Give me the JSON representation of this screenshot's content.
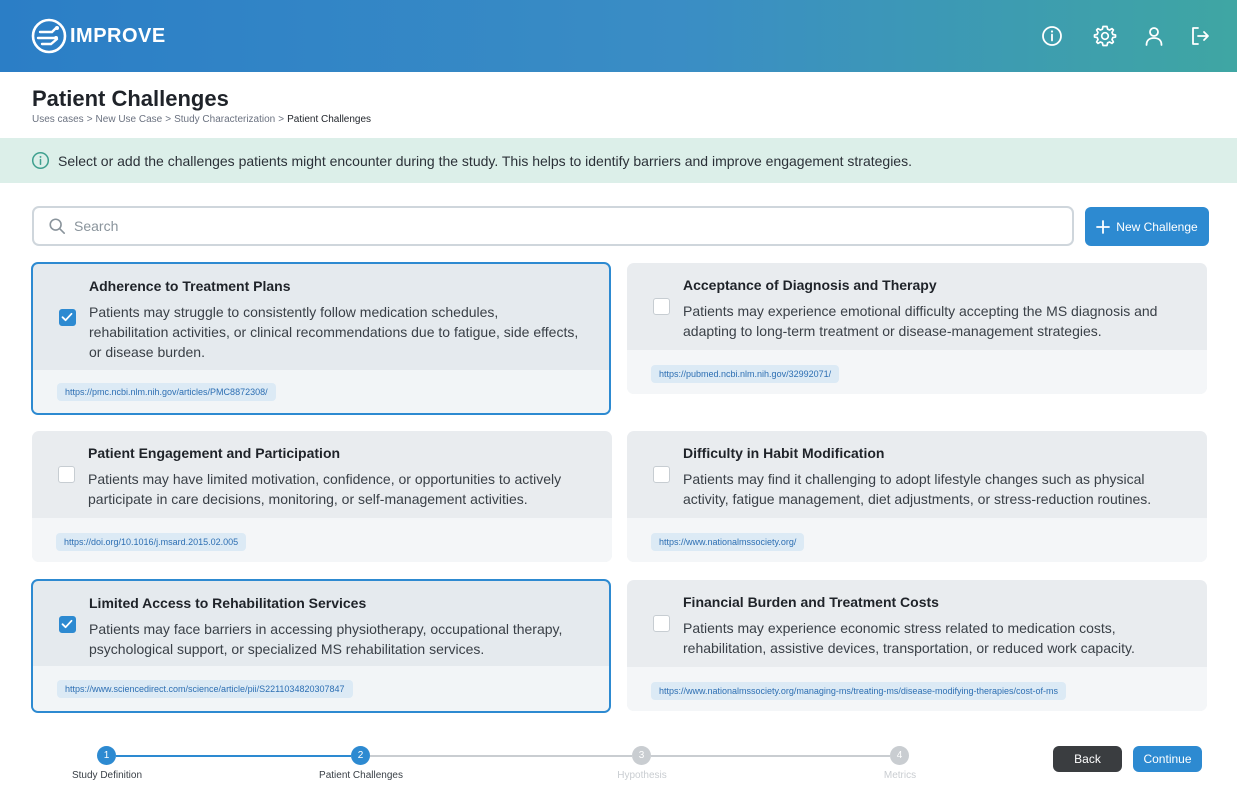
{
  "app": {
    "logo_text": "IMPROVE",
    "header_icons": [
      "info-icon",
      "gear-icon",
      "user-icon",
      "logout-icon"
    ]
  },
  "page": {
    "title": "Patient Challenges",
    "breadcrumb": [
      "Uses cases",
      "New Use Case",
      "Study Characterization",
      "Patient Challenges"
    ],
    "breadcrumb_sep": ">"
  },
  "banner": {
    "text": "Select or add the challenges patients might encounter during the study. This helps to identify barriers and improve engagement strategies."
  },
  "search": {
    "placeholder": "Search",
    "value": ""
  },
  "new_challenge_label": "New Challenge",
  "challenges": [
    {
      "title": "Adherence to Treatment Plans",
      "description": "Patients may struggle to consistently follow medication schedules, rehabilitation activities, or clinical recommendations due to fatigue, side effects, or disease burden.",
      "link": "https://pmc.ncbi.nlm.nih.gov/articles/PMC8872308/",
      "checked": true
    },
    {
      "title": "Acceptance of Diagnosis and Therapy",
      "description": "Patients may experience emotional difficulty accepting the MS diagnosis and adapting to long-term treatment or disease-management strategies.",
      "link": "https://pubmed.ncbi.nlm.nih.gov/32992071/",
      "checked": false
    },
    {
      "title": "Patient Engagement and Participation",
      "description": "Patients may have limited motivation, confidence, or opportunities to actively participate in care decisions, monitoring, or self-management activities.",
      "link": "https://doi.org/10.1016/j.msard.2015.02.005",
      "checked": false
    },
    {
      "title": "Difficulty in Habit Modification",
      "description": "Patients may find it challenging to adopt lifestyle changes such as physical activity, fatigue management, diet adjustments, or stress-reduction routines.",
      "link": "https://www.nationalmssociety.org/",
      "checked": false
    },
    {
      "title": "Limited Access to Rehabilitation Services",
      "description": "Patients may face barriers in accessing physiotherapy, occupational therapy, psychological support, or specialized MS rehabilitation services.",
      "link": "https://www.sciencedirect.com/science/article/pii/S2211034820307847",
      "checked": true
    },
    {
      "title": "Financial Burden and Treatment Costs",
      "description": "Patients may experience economic stress related to medication costs, rehabilitation, assistive devices, transportation, or reduced work capacity.",
      "link": "https://www.nationalmssociety.org/managing-ms/treating-ms/disease-modifying-therapies/cost-of-ms",
      "checked": false
    }
  ],
  "stepper": {
    "steps": [
      {
        "number": "1",
        "label": "Study Definition",
        "state": "done"
      },
      {
        "number": "2",
        "label": "Patient Challenges",
        "state": "active"
      },
      {
        "number": "3",
        "label": "Hypothesis",
        "state": "pending"
      },
      {
        "number": "4",
        "label": "Metrics",
        "state": "pending"
      }
    ]
  },
  "actions": {
    "back_label": "Back",
    "continue_label": "Continue"
  },
  "colors": {
    "primary": "#2d8ad1",
    "banner_bg": "#dcefe9",
    "card_bg": "#e9ecef",
    "dark_button": "#3a3d40",
    "pending": "#c9cdd1"
  }
}
